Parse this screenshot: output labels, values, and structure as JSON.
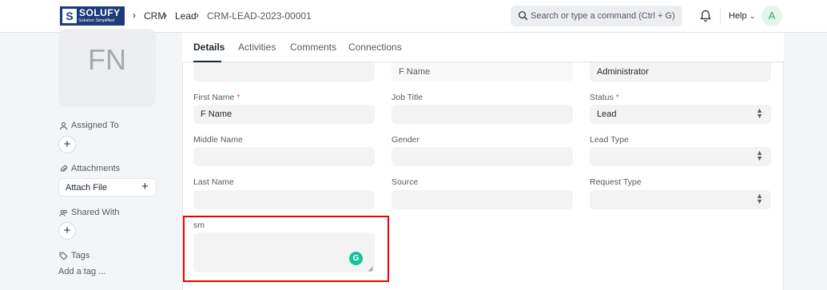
{
  "navbar": {
    "logo_mark": "S",
    "logo_text": "SOLUFY",
    "logo_tagline": "Solution Simplified",
    "breadcrumbs": [
      "CRM",
      "Lead",
      "CRM-LEAD-2023-00001"
    ],
    "search_placeholder": "Search or type a command (Ctrl + G)",
    "help_label": "Help",
    "avatar_initial": "A"
  },
  "sidebar": {
    "image_initials": "FN",
    "assigned_to_label": "Assigned To",
    "attachments_label": "Attachments",
    "attach_file_label": "Attach File",
    "shared_with_label": "Shared With",
    "tags_label": "Tags",
    "add_tag_label": "Add a tag ..."
  },
  "tabs": [
    "Details",
    "Activities",
    "Comments",
    "Connections"
  ],
  "form": {
    "top_row": {
      "col1_value": "",
      "col2_value": "F Name",
      "col3_value": "Administrator"
    },
    "first_name": {
      "label": "First Name",
      "required": "*",
      "value": "F Name"
    },
    "job_title": {
      "label": "Job Title",
      "value": ""
    },
    "status": {
      "label": "Status",
      "required": "*",
      "value": "Lead"
    },
    "middle_name": {
      "label": "Middle Name",
      "value": ""
    },
    "gender": {
      "label": "Gender",
      "value": ""
    },
    "lead_type": {
      "label": "Lead Type",
      "value": ""
    },
    "last_name": {
      "label": "Last Name",
      "value": ""
    },
    "source": {
      "label": "Source",
      "value": ""
    },
    "request_type": {
      "label": "Request Type",
      "value": ""
    },
    "sm": {
      "label": "sm",
      "value": ""
    }
  },
  "colors": {
    "highlight": "#ee0000",
    "grammarly": "#15c39a",
    "required": "#e24c4c"
  }
}
